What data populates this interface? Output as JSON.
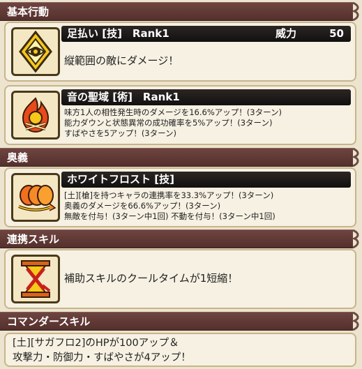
{
  "sections": {
    "basic": "基本行動",
    "ougi": "奥義",
    "link": "連携スキル",
    "commander": "コマンダースキル"
  },
  "skill1": {
    "title": "足払い [技]　Rank1",
    "power_label": "威力",
    "power_value": "50",
    "desc": "縦範囲の敵にダメージ！"
  },
  "skill2": {
    "title": "音の聖域 [術]　Rank1",
    "lines": [
      "味方1人の相性発生時のダメージを16.6%アップ！(3ターン)",
      "能力ダウンと状態異常の成功確率を5%アップ！(3ターン)",
      "すばやさを5アップ！(3ターン)"
    ]
  },
  "ougi": {
    "title": "ホワイトフロスト [技]",
    "lines": [
      "[土][槍]を持つキャラの連携率を33.3%アップ！(3ターン)",
      "奥義のダメージを66.6%アップ！(3ターン)",
      "無敵を付与！(3ターン中1回) 不動を付与！(3ターン中1回)"
    ]
  },
  "link": {
    "desc": "補助スキルのクールタイムが1短縮！"
  },
  "commander": {
    "lines": [
      "[土][サガフロ2]のHPが100アップ＆",
      "攻撃力・防御力・すばやさが4アップ！"
    ]
  },
  "icons": [
    "eye-diamond-icon",
    "fire-crossbones-icon",
    "fire-rings-icon",
    "hourglass-x-icon"
  ],
  "colors": {
    "header": "#5e3834",
    "card": "#f6f1e2",
    "border": "#c7b48a",
    "bar": "#1c1816"
  }
}
